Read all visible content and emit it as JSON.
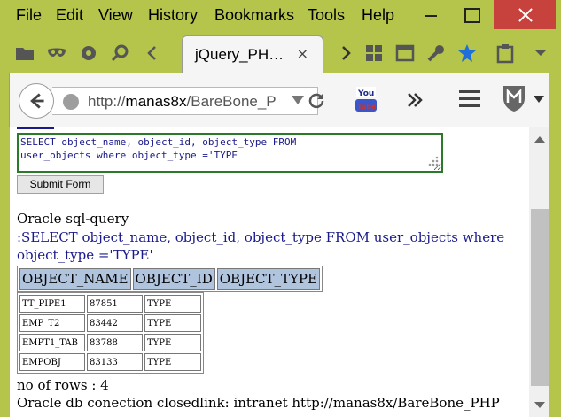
{
  "menubar": {
    "items": [
      "File",
      "Edit",
      "View",
      "History",
      "Bookmarks",
      "Tools",
      "Help"
    ]
  },
  "tab": {
    "title": "jQuery_PH…",
    "close": "×"
  },
  "navbar": {
    "url_prefix": "http://",
    "url_host": "manas8x",
    "url_path": "/BareBone_P"
  },
  "form": {
    "textarea_value": "SELECT object_name, object_id, object_type FROM\nuser_objects where object_type ='TYPE",
    "submit_label": "Submit Form"
  },
  "result": {
    "label": "Oracle sql-query",
    "query_line1": ":SELECT object_name, object_id, object_type FROM user_objects where",
    "query_line2": "object_type ='TYPE'",
    "headers": [
      "OBJECT_NAME",
      "OBJECT_ID",
      "OBJECT_TYPE"
    ],
    "rows": [
      [
        "TT_PIPE1",
        "87851",
        "TYPE"
      ],
      [
        "EMP_T2",
        "83442",
        "TYPE"
      ],
      [
        "EMPT1_TAB",
        "83788",
        "TYPE"
      ],
      [
        "EMPOBJ",
        "83133",
        "TYPE"
      ]
    ],
    "row_count": "no of rows : 4",
    "footer": "Oracle db conection closedlink: intranet http://manas8x/BareBone_PHP"
  },
  "colors": {
    "chrome": "#b5c44a",
    "close_button": "#c7413d",
    "header_cell": "#b0c4de",
    "textarea_border": "#2a7a2a",
    "query_text": "#1a1a8a"
  }
}
